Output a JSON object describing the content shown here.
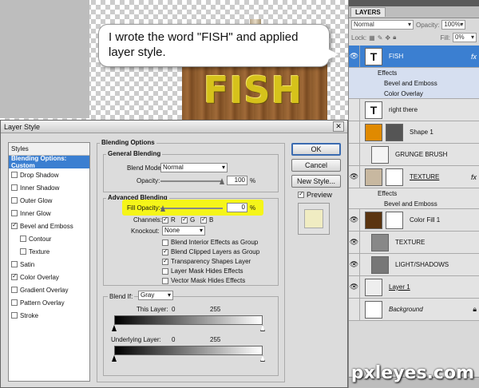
{
  "callout": {
    "text": "I wrote the word \"FISH\" and applied layer style."
  },
  "sign": {
    "word": "FISH"
  },
  "layers_panel": {
    "tab": "LAYERS",
    "blend_mode": "Normal",
    "opacity_label": "Opacity:",
    "opacity_value": "100%",
    "lock_label": "Lock:",
    "fill_label": "Fill:",
    "fill_value": "0%",
    "layers": [
      {
        "name": "FISH",
        "thumb": "T",
        "selected": true,
        "fx": "fx"
      },
      {
        "name": "Effects",
        "sub": true
      },
      {
        "name": "Bevel and Emboss",
        "sub": true
      },
      {
        "name": "Color Overlay",
        "sub": true
      },
      {
        "name": "right there",
        "thumb": "T"
      },
      {
        "name": "Shape 1"
      },
      {
        "name": "GRUNGE BRUSH"
      },
      {
        "name": "TEXTURE",
        "fx": "fx"
      },
      {
        "name": "Effects",
        "sub": true
      },
      {
        "name": "Bevel and Emboss",
        "sub": true
      },
      {
        "name": "Color Fill 1"
      },
      {
        "name": "TEXTURE"
      },
      {
        "name": "LIGHT/SHADOWS"
      },
      {
        "name": "Layer 1"
      },
      {
        "name": "Background"
      }
    ]
  },
  "dialog": {
    "title": "Layer Style",
    "styles_header": "Styles",
    "styles": [
      {
        "label": "Blending Options: Custom",
        "active": true
      },
      {
        "label": "Drop Shadow",
        "checked": false
      },
      {
        "label": "Inner Shadow",
        "checked": false
      },
      {
        "label": "Outer Glow",
        "checked": false
      },
      {
        "label": "Inner Glow",
        "checked": false
      },
      {
        "label": "Bevel and Emboss",
        "checked": true
      },
      {
        "label": "Contour",
        "checked": false,
        "indent": true
      },
      {
        "label": "Texture",
        "checked": false,
        "indent": true
      },
      {
        "label": "Satin",
        "checked": false
      },
      {
        "label": "Color Overlay",
        "checked": true
      },
      {
        "label": "Gradient Overlay",
        "checked": false
      },
      {
        "label": "Pattern Overlay",
        "checked": false
      },
      {
        "label": "Stroke",
        "checked": false
      }
    ],
    "blending_options": "Blending Options",
    "general_blending": "General Blending",
    "blend_mode_label": "Blend Mode:",
    "blend_mode_value": "Normal",
    "opacity_label": "Opacity:",
    "opacity_value": "100",
    "percent": "%",
    "advanced_blending": "Advanced Blending",
    "fill_opacity_label": "Fill Opacity:",
    "fill_opacity_value": "0",
    "channels_label": "Channels:",
    "channel_r": "R",
    "channel_g": "G",
    "channel_b": "B",
    "knockout_label": "Knockout:",
    "knockout_value": "None",
    "checkboxes": [
      {
        "label": "Blend Interior Effects as Group",
        "checked": false
      },
      {
        "label": "Blend Clipped Layers as Group",
        "checked": true
      },
      {
        "label": "Transparency Shapes Layer",
        "checked": true
      },
      {
        "label": "Layer Mask Hides Effects",
        "checked": false
      },
      {
        "label": "Vector Mask Hides Effects",
        "checked": false
      }
    ],
    "blend_if_label": "Blend If:",
    "blend_if_value": "Gray",
    "this_layer_label": "This Layer:",
    "this_layer_min": "0",
    "this_layer_max": "255",
    "underlying_label": "Underlying Layer:",
    "underlying_min": "0",
    "underlying_max": "255",
    "ok": "OK",
    "cancel": "Cancel",
    "new_style": "New Style...",
    "preview": "Preview"
  },
  "watermark": "pxleyes.com"
}
